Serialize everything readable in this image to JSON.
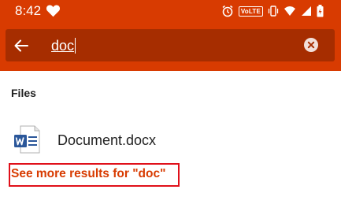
{
  "status_bar": {
    "time": "8:42",
    "volte_label": "VoLTE",
    "icons": [
      "heart-icon",
      "alarm-icon",
      "volte-icon",
      "vibrate-icon",
      "wifi-icon",
      "signal-icon",
      "battery-icon"
    ]
  },
  "search": {
    "value": "doc",
    "back_icon": "arrow-left-icon",
    "clear_icon": "clear-circle-icon"
  },
  "results": {
    "section_title": "Files",
    "files": [
      {
        "name": "Document.docx",
        "icon": "word-document-icon"
      }
    ],
    "see_more_label": "See more results for \"doc\""
  },
  "colors": {
    "accent": "#D83B01",
    "search_box": "#A62D00",
    "highlight_border": "#E0101A",
    "word_blue": "#2B579A"
  }
}
